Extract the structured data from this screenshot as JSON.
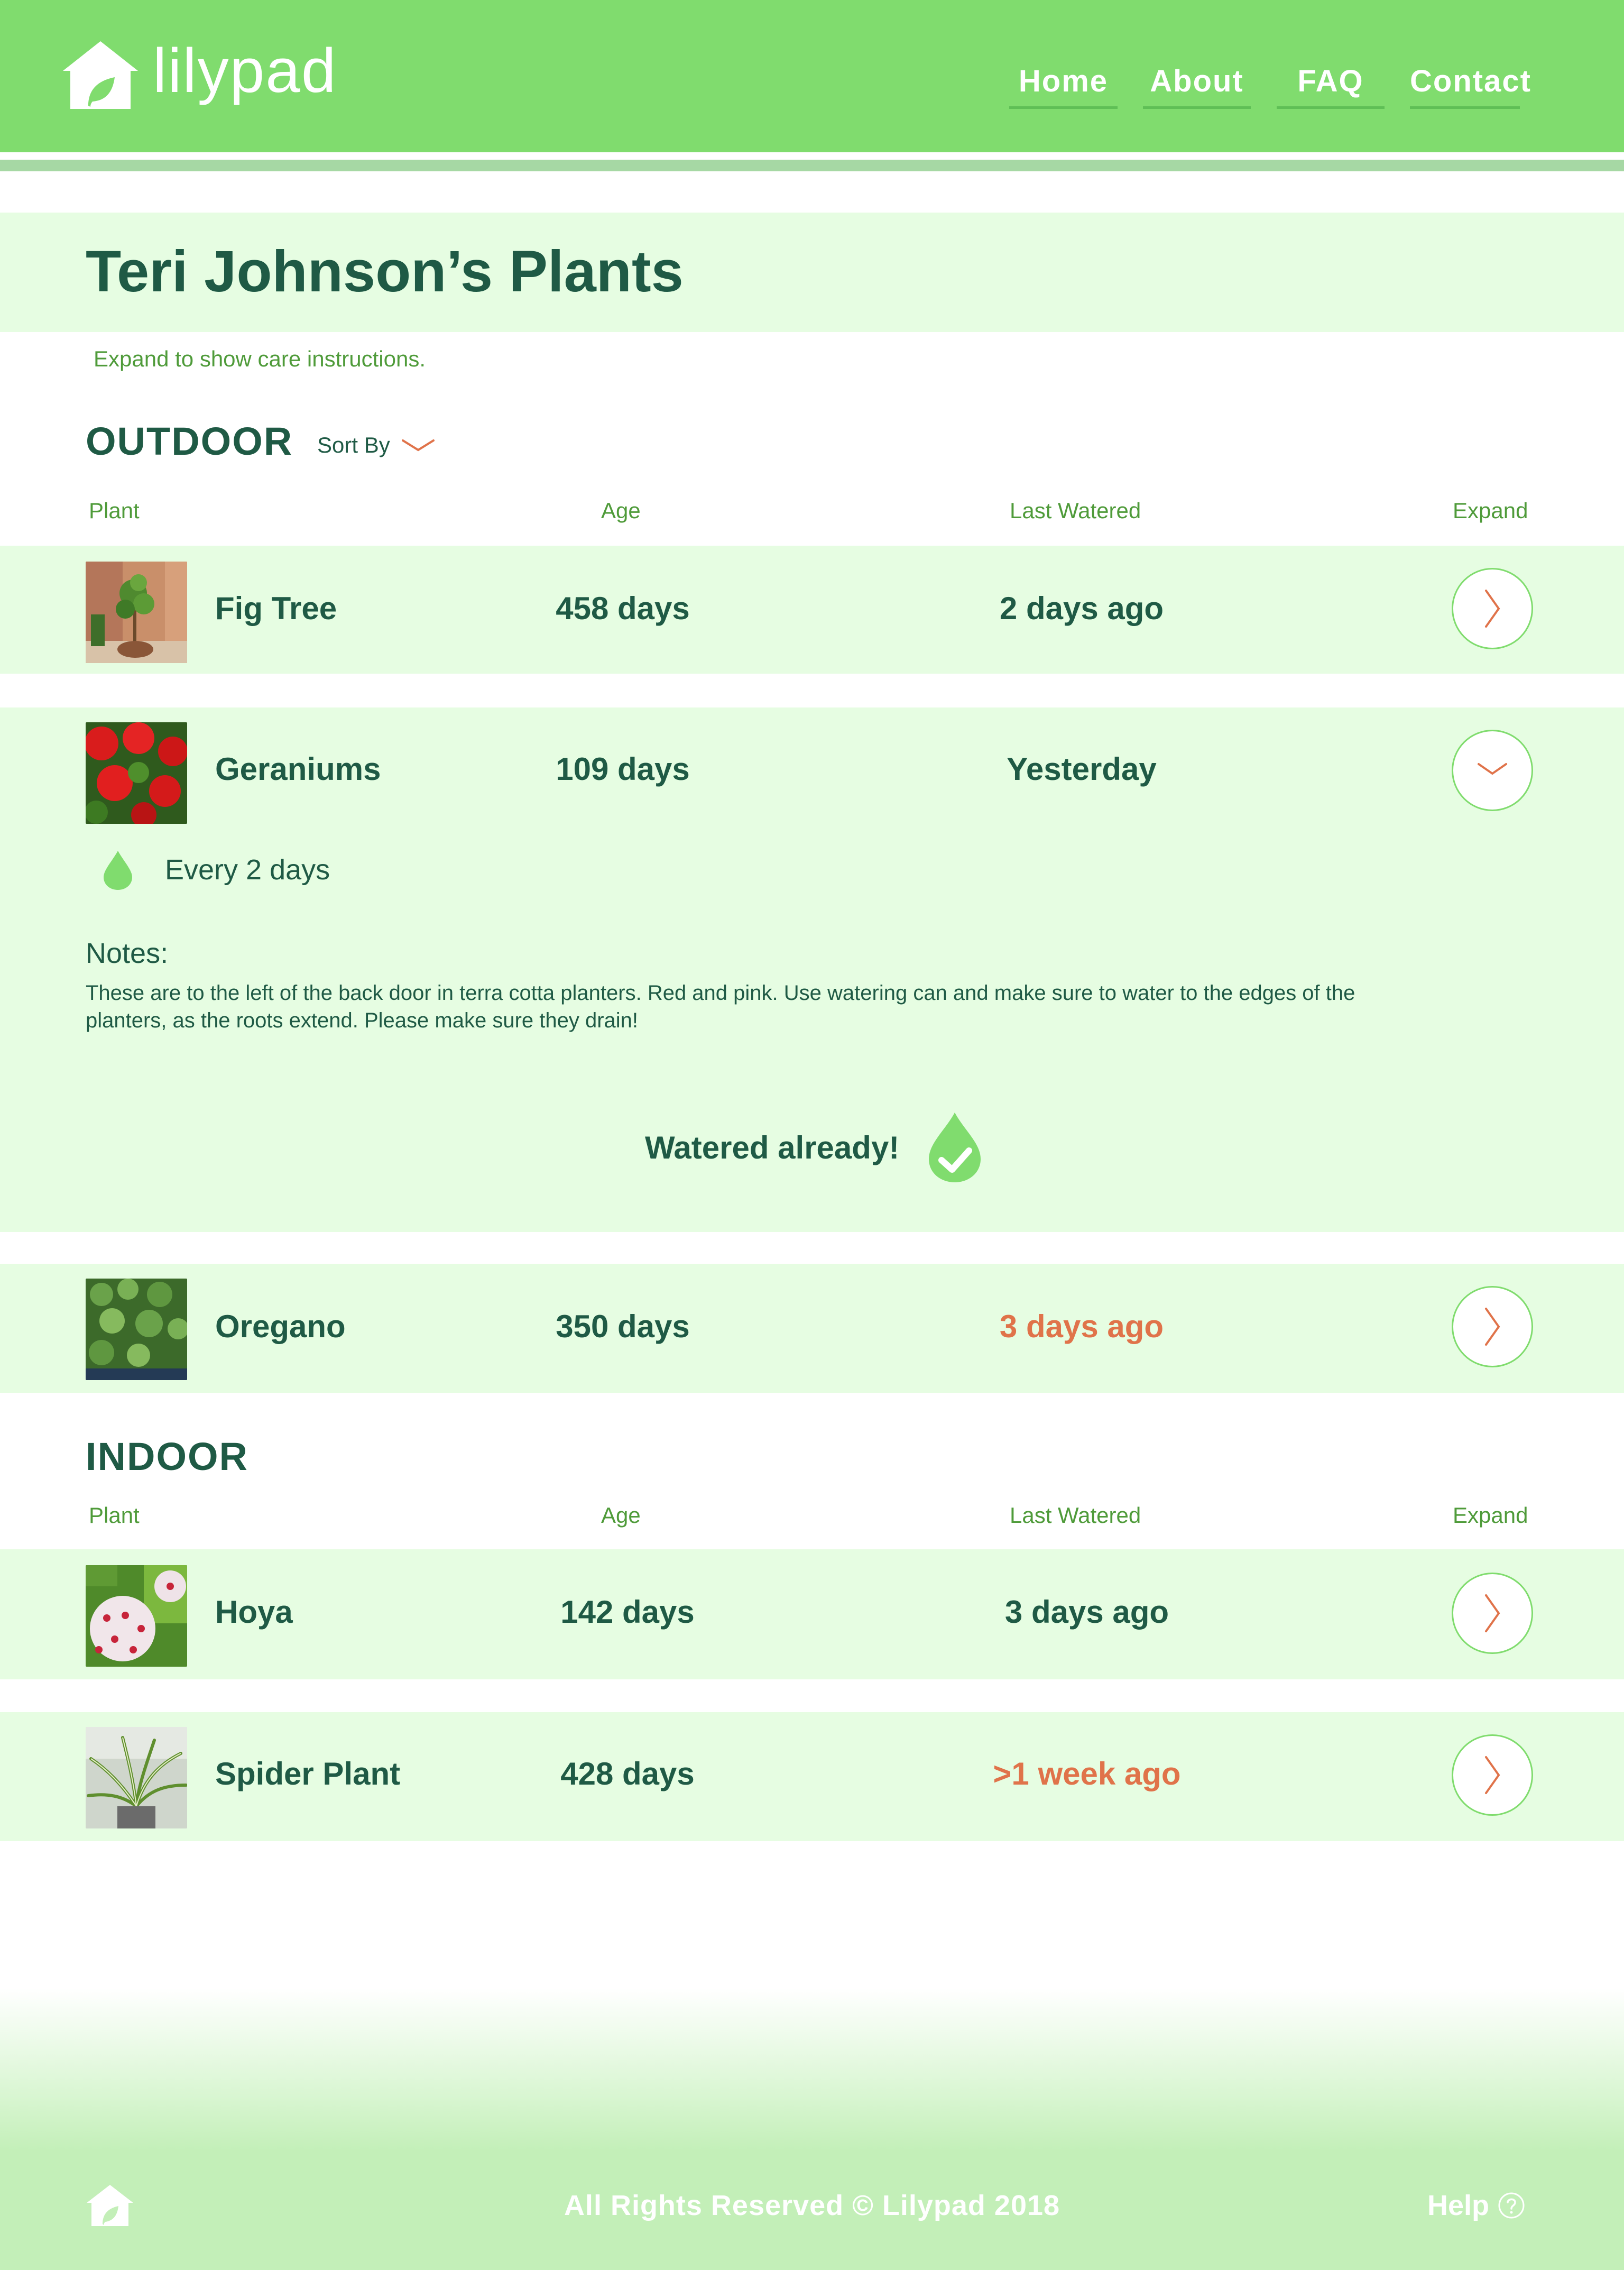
{
  "app": {
    "logo_text": "lilypad"
  },
  "nav": {
    "items": [
      "Home",
      "About",
      "FAQ",
      "Contact"
    ]
  },
  "page": {
    "title": "Teri Johnson’s Plants",
    "hint": "Expand to show care instructions."
  },
  "columns": {
    "plant": "Plant",
    "age": "Age",
    "last_watered": "Last Watered",
    "expand": "Expand"
  },
  "outdoor": {
    "title": "OUTDOOR",
    "sort_label": "Sort By",
    "plants": [
      {
        "name": "Fig Tree",
        "age": "458 days",
        "last_watered": "2 days ago",
        "overdue": false,
        "expanded": false
      },
      {
        "name": "Geraniums",
        "age": "109 days",
        "last_watered": "Yesterday",
        "overdue": false,
        "expanded": true,
        "frequency": "Every 2 days",
        "notes_label": "Notes:",
        "notes": "These are to the left of the back door in terra cotta planters.  Red and pink.  Use watering can and make sure to water to the edges of the planters, as the roots extend.  Please make sure they drain!",
        "watered_status": "Watered already!"
      },
      {
        "name": "Oregano",
        "age": "350 days",
        "last_watered": "3 days ago",
        "overdue": true,
        "expanded": false
      }
    ]
  },
  "indoor": {
    "title": "INDOOR",
    "plants": [
      {
        "name": "Hoya",
        "age": "142 days",
        "last_watered": "3 days ago",
        "overdue": false,
        "expanded": false
      },
      {
        "name": "Spider Plant",
        "age": "428 days",
        "last_watered": ">1 week ago",
        "overdue": true,
        "expanded": false
      }
    ]
  },
  "footer": {
    "copyright": "All Rights Reserved © Lilypad  2018",
    "help": "Help"
  },
  "colors": {
    "brand_green": "#80dc6e",
    "row_tint": "#e6fde2",
    "text_dark": "#1f5a45",
    "label_green": "#4f9b3a",
    "overdue_orange": "#e0734a"
  },
  "icons": [
    "house-logo-icon",
    "chevron-down-icon",
    "chevron-right-icon",
    "water-drop-icon",
    "water-drop-check-icon",
    "question-circle-icon"
  ]
}
